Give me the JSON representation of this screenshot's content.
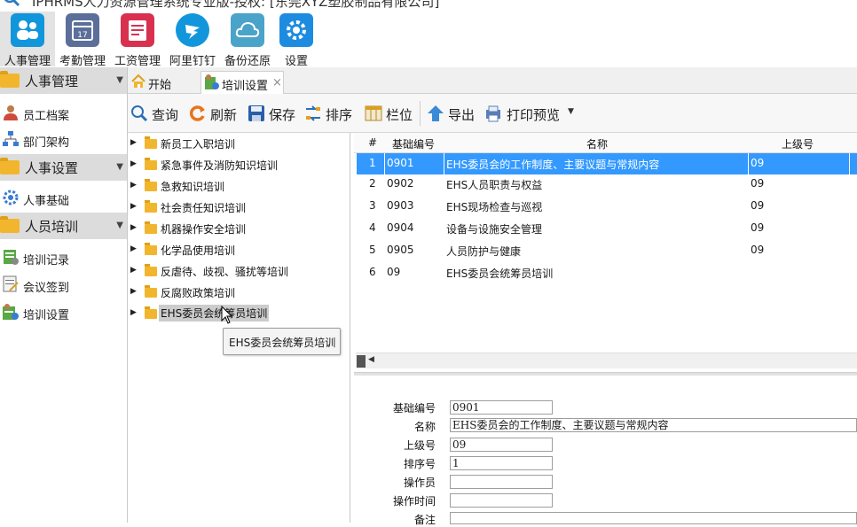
{
  "window": {
    "title": "IPHRMS人力资源管理系统专业版-授权: [东莞XYZ塑胶制品有限公司]"
  },
  "modules": [
    {
      "label": "人事管理",
      "icon": "people-icon",
      "color": "#1296db"
    },
    {
      "label": "考勤管理",
      "icon": "calendar-icon",
      "color": "#5b6f9a"
    },
    {
      "label": "工资管理",
      "icon": "payroll-icon",
      "color": "#d9304f"
    },
    {
      "label": "阿里钉钉",
      "icon": "dingtalk-icon",
      "color": "#1296db"
    },
    {
      "label": "备份还原",
      "icon": "cloud-icon",
      "color": "#4aa3c8"
    },
    {
      "label": "设置",
      "icon": "gear-icon",
      "color": "#1d8ce0"
    }
  ],
  "sidebar": {
    "sections": [
      {
        "label": "人事管理",
        "items": [
          {
            "label": "员工档案",
            "icon": "employee-icon"
          },
          {
            "label": "部门架构",
            "icon": "org-chart-icon"
          }
        ]
      },
      {
        "label": "人事设置",
        "items": [
          {
            "label": "人事基础",
            "icon": "gear-icon"
          }
        ]
      },
      {
        "label": "人员培训",
        "items": [
          {
            "label": "培训记录",
            "icon": "training-record-icon"
          },
          {
            "label": "会议签到",
            "icon": "meeting-signin-icon"
          },
          {
            "label": "培训设置",
            "icon": "training-settings-icon"
          }
        ]
      }
    ]
  },
  "tabs": [
    {
      "label": "开始",
      "icon": "home-icon"
    },
    {
      "label": "培训设置",
      "icon": "training-settings-icon",
      "close": "×"
    }
  ],
  "toolbar": {
    "query": "查询",
    "refresh": "刷新",
    "save": "保存",
    "sort": "排序",
    "columns": "栏位",
    "export": "导出",
    "print_preview": "打印预览"
  },
  "tree": {
    "nodes": [
      "新员工入职培训",
      "紧急事件及消防知识培训",
      "急救知识培训",
      "社会责任知识培训",
      "机器操作安全培训",
      "化学品使用培训",
      "反虐待、歧视、骚扰等培训",
      "反腐败政策培训",
      "EHS委员会统筹员培训"
    ],
    "tooltip": "EHS委员会统筹员培训"
  },
  "grid": {
    "columns": {
      "num": "#",
      "code": "基础编号",
      "name": "名称",
      "parent": "上级号"
    },
    "rows": [
      {
        "num": "1",
        "code": "0901",
        "name": "EHS委员会的工作制度、主要议题与常规内容",
        "parent": "09"
      },
      {
        "num": "2",
        "code": "0902",
        "name": "EHS人员职责与权益",
        "parent": "09"
      },
      {
        "num": "3",
        "code": "0903",
        "name": "EHS现场检查与巡视",
        "parent": "09"
      },
      {
        "num": "4",
        "code": "0904",
        "name": "设备与设施安全管理",
        "parent": "09"
      },
      {
        "num": "5",
        "code": "0905",
        "name": "人员防护与健康",
        "parent": "09"
      },
      {
        "num": "6",
        "code": "09",
        "name": "EHS委员会统筹员培训",
        "parent": ""
      }
    ]
  },
  "form": {
    "code_label": "基础编号",
    "code_value": "0901",
    "name_label": "名称",
    "name_value": "EHS委员会的工作制度、主要议题与常规内容",
    "parent_label": "上级号",
    "parent_value": "09",
    "sort_label": "排序号",
    "sort_value": "1",
    "operator_label": "操作员",
    "operator_value": "",
    "optime_label": "操作时间",
    "optime_value": "",
    "remark_label": "备注"
  },
  "colors": {
    "selection": "#3399ff",
    "folder": "#f2b62e",
    "section_bg": "#dcdcdc"
  }
}
